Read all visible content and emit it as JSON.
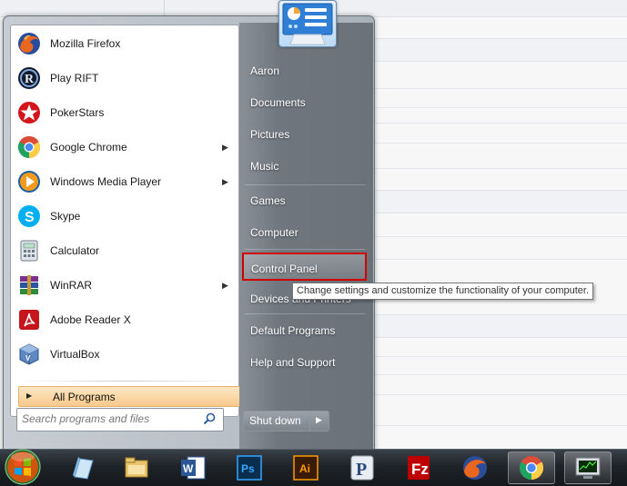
{
  "programs": [
    {
      "label": "Mozilla Firefox",
      "icon": "firefox-icon",
      "submenu": false
    },
    {
      "label": "Play RIFT",
      "icon": "rift-icon",
      "submenu": false
    },
    {
      "label": "PokerStars",
      "icon": "pokerstars-icon",
      "submenu": false
    },
    {
      "label": "Google Chrome",
      "icon": "chrome-icon",
      "submenu": true
    },
    {
      "label": "Windows Media Player",
      "icon": "media-player-icon",
      "submenu": true
    },
    {
      "label": "Skype",
      "icon": "skype-icon",
      "submenu": false
    },
    {
      "label": "Calculator",
      "icon": "calculator-icon",
      "submenu": false
    },
    {
      "label": "WinRAR",
      "icon": "winrar-icon",
      "submenu": true
    },
    {
      "label": "Adobe Reader X",
      "icon": "adobe-reader-icon",
      "submenu": false
    },
    {
      "label": "VirtualBox",
      "icon": "virtualbox-icon",
      "submenu": false
    }
  ],
  "all_programs_label": "All Programs",
  "search": {
    "placeholder": "Search programs and files"
  },
  "right_items": {
    "user": "Aaron",
    "documents": "Documents",
    "pictures": "Pictures",
    "music": "Music",
    "games": "Games",
    "computer": "Computer",
    "control_panel": "Control Panel",
    "devices_printers": "Devices and Printers",
    "default_programs": "Default Programs",
    "help_support": "Help and Support"
  },
  "shutdown_label": "Shut down",
  "tooltip": "Change settings and customize the functionality of your computer.",
  "highlight_color": "#d00000",
  "taskbar_items": [
    "windows-explorer-icon",
    "file-manager-icon",
    "word-icon",
    "photoshop-icon",
    "illustrator-icon",
    "pandora-icon",
    "filezilla-icon",
    "firefox-icon",
    "chrome-icon",
    "task-manager-icon"
  ]
}
